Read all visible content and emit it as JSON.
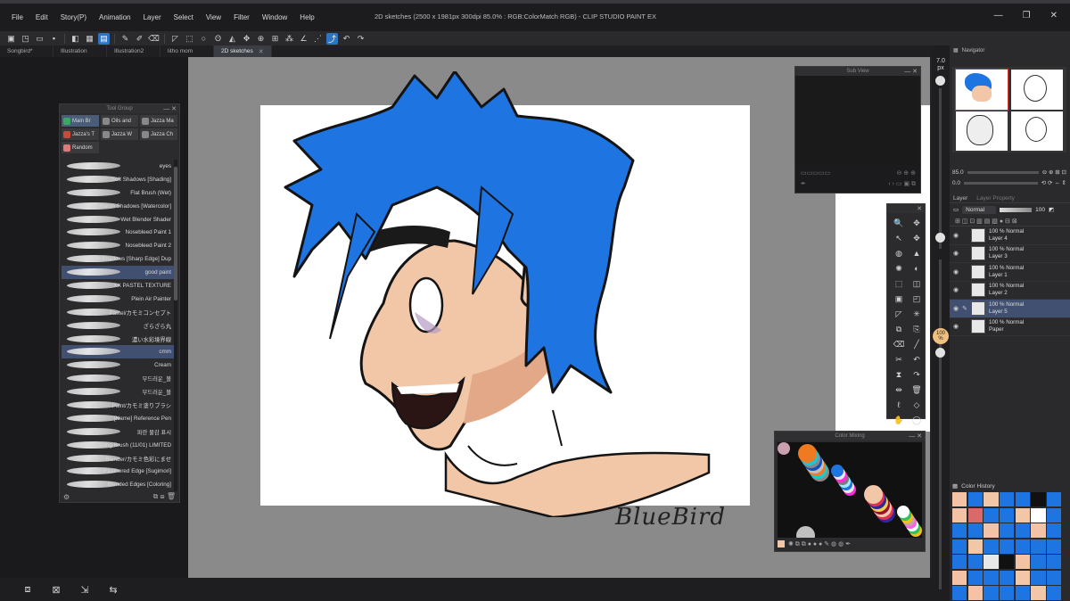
{
  "window": {
    "title": "2D sketches (2500 x 1981px 300dpi 85.0% : RGB:ColorMatch RGB) - CLIP STUDIO PAINT EX",
    "controls": [
      "—",
      "❐",
      "✕"
    ]
  },
  "menu": [
    "File",
    "Edit",
    "Story(P)",
    "Animation",
    "Layer",
    "Select",
    "View",
    "Filter",
    "Window",
    "Help"
  ],
  "tabs": [
    {
      "label": "Songbird*",
      "active": false
    },
    {
      "label": "Illustration",
      "active": false
    },
    {
      "label": "Illustration2",
      "active": false
    },
    {
      "label": "litho mom",
      "active": false
    },
    {
      "label": "2D sketches",
      "active": true
    }
  ],
  "tool_group": {
    "title": "Tool Group",
    "tabs": [
      "Main Br",
      "Oils and",
      "Jazza Ma",
      "Jazza's T",
      "Jazza W",
      "Jazza Ch",
      "Random"
    ],
    "brushes": [
      {
        "label": "eyes",
        "selected": false
      },
      {
        "label": "Soft Shadows [Shading]",
        "selected": false
      },
      {
        "label": "Flat Brush (Wet)",
        "selected": false
      },
      {
        "label": "Harsh Shadows [Watercolor]",
        "selected": false
      },
      {
        "label": "Wet Blender Shader",
        "selected": false
      },
      {
        "label": "Nosebleed Paint 1",
        "selected": false
      },
      {
        "label": "Nosebleed Paint 2",
        "selected": false
      },
      {
        "label": "Harsh Shadows [Sharp Edge] Dup",
        "selected": false
      },
      {
        "label": "good paint",
        "selected": true
      },
      {
        "label": "SK PASTEL TEXTURE",
        "selected": false
      },
      {
        "label": "Plein Air Painter",
        "selected": false
      },
      {
        "label": "Pastel/カモミコンセプト",
        "selected": false
      },
      {
        "label": "ざらざら丸",
        "selected": false
      },
      {
        "label": "濃い水彩境界線",
        "selected": false
      },
      {
        "label": "cmm",
        "selected": true
      },
      {
        "label": "Cream",
        "selected": false
      },
      {
        "label": "부드러운_볼",
        "selected": false
      },
      {
        "label": "부드러운_볼",
        "selected": false
      },
      {
        "label": "Paint/カモミ塗りブラシ",
        "selected": false
      },
      {
        "label": "[Name] Reference Pen",
        "selected": false
      },
      {
        "label": "파란 물감 표시",
        "selected": false
      },
      {
        "label": "Soft Coloring Brush (11/01) LIMITED",
        "selected": false
      },
      {
        "label": "Blender/カモミ色彩にませ",
        "selected": false
      },
      {
        "label": "Feathered Edge [Sugimori]",
        "selected": false
      },
      {
        "label": "Blended Edges [Coloring]",
        "selected": false
      }
    ]
  },
  "sub_view": {
    "title": "Sub View"
  },
  "color_mixing": {
    "title": "Color Mixing"
  },
  "canvas": {
    "signature": "BlueBird",
    "colors": {
      "hair": "#1e74e0",
      "skin": "#f2c7a8",
      "outline": "#141414"
    }
  },
  "dock": {
    "brush_size": "7.0",
    "brush_unit": "px",
    "zoom": "100",
    "zoom_unit": "%",
    "navigator_tab": "Navigator",
    "nav_zoom": "85.0",
    "nav_rotate": "0.0"
  },
  "layer_panel": {
    "tabs": [
      "Layer",
      "Layer Property"
    ],
    "blend_mode": "Normal",
    "opacity": "100",
    "layers": [
      {
        "opacity": "100 % Normal",
        "name": "Layer 4",
        "selected": false,
        "editing": false
      },
      {
        "opacity": "100 % Normal",
        "name": "Layer 3",
        "selected": false,
        "editing": false
      },
      {
        "opacity": "100 % Normal",
        "name": "Layer 1",
        "selected": false,
        "editing": false
      },
      {
        "opacity": "100 % Normal",
        "name": "Layer 2",
        "selected": false,
        "editing": false
      },
      {
        "opacity": "100 % Normal",
        "name": "Layer 5",
        "selected": true,
        "editing": true
      },
      {
        "opacity": "100 % Normal",
        "name": "Paper",
        "selected": false,
        "editing": false
      }
    ]
  },
  "color_history": {
    "title": "Color History",
    "colors": [
      "#f4c3a6",
      "#1e74e0",
      "#f2c7a8",
      "#1e74e0",
      "#1e74e0",
      "#111111",
      "#1e74e0",
      "#f4c3a6",
      "#d86a6a",
      "#1e74e0",
      "#1e74e0",
      "#f2c7a8",
      "#ffffff",
      "#1e74e0",
      "#1e74e0",
      "#1e74e0",
      "#f4c3a6",
      "#1e74e0",
      "#1e74e0",
      "#f4c3a6",
      "#1e74e0",
      "#1e74e0",
      "#f2c7a8",
      "#1e74e0",
      "#1e74e0",
      "#1e74e0",
      "#1e74e0",
      "#1e74e0",
      "#1e74e0",
      "#1e74e0",
      "#e8e8e8",
      "#111111",
      "#f4c3a6",
      "#1e74e0",
      "#1e74e0",
      "#f4c3a6",
      "#1e74e0",
      "#1e74e0",
      "#1e74e0",
      "#f2c7a8",
      "#1e74e0",
      "#1e74e0",
      "#1e74e0",
      "#f4c3a6",
      "#1e74e0",
      "#1e74e0",
      "#1e74e0",
      "#f2c7a8",
      "#1e74e0"
    ]
  }
}
